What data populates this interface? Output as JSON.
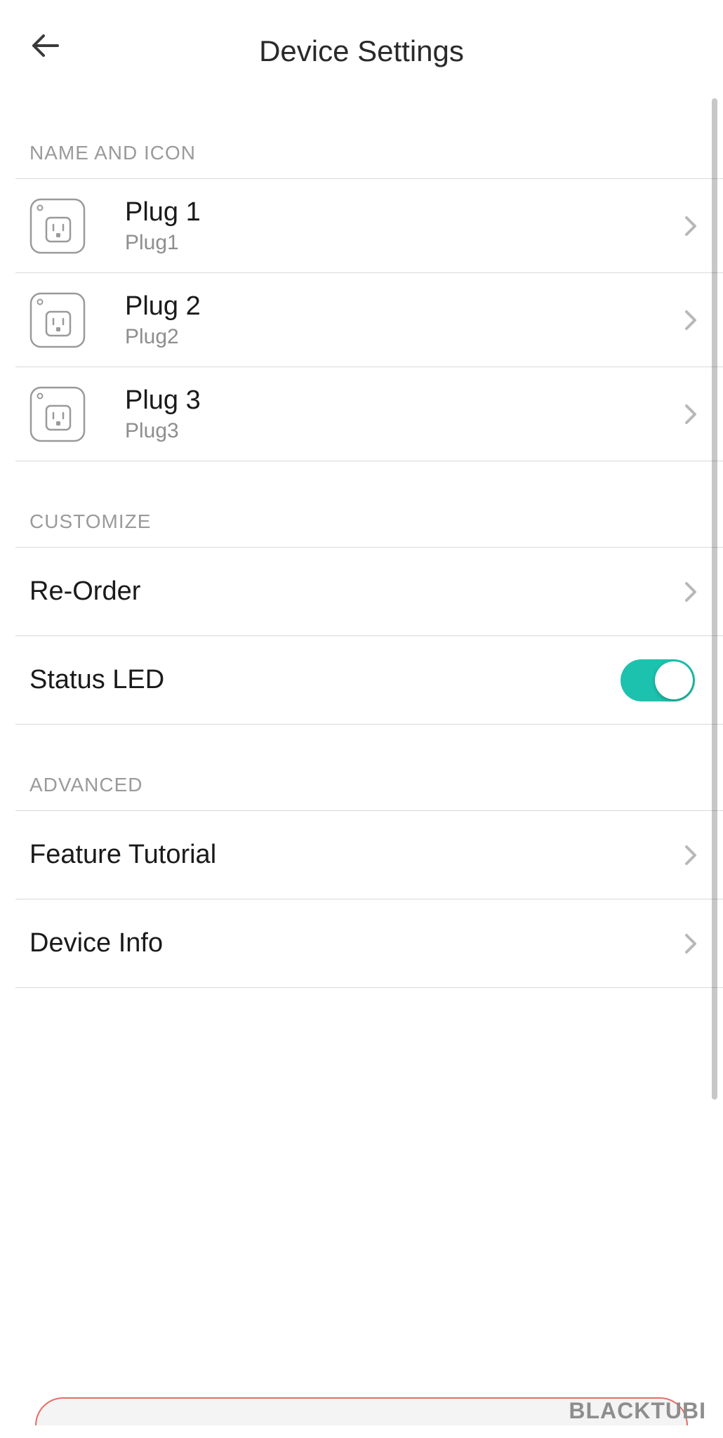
{
  "header": {
    "title": "Device Settings"
  },
  "sections": {
    "name_icon": {
      "header": "NAME AND ICON",
      "plugs": [
        {
          "title": "Plug 1",
          "sub": "Plug1"
        },
        {
          "title": "Plug 2",
          "sub": "Plug2"
        },
        {
          "title": "Plug 3",
          "sub": "Plug3"
        }
      ]
    },
    "customize": {
      "header": "CUSTOMIZE",
      "reorder": "Re-Order",
      "status_led": "Status LED"
    },
    "advanced": {
      "header": "ADVANCED",
      "feature_tutorial": "Feature Tutorial",
      "device_info": "Device Info"
    }
  },
  "watermark": "BLACKTUBI"
}
